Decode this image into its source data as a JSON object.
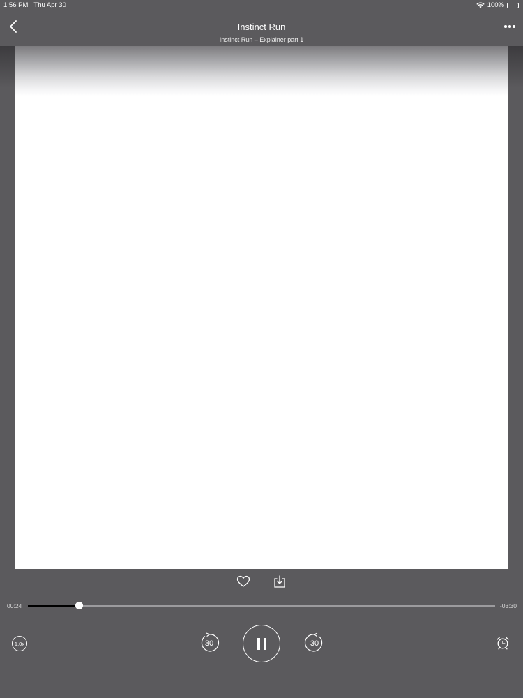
{
  "status_bar": {
    "time": "1:56 PM",
    "date": "Thu Apr 30",
    "battery": "100%",
    "icons": [
      "wifi-icon",
      "battery-icon"
    ]
  },
  "nav": {
    "title": "Instinct Run",
    "subtitle": "Instinct Run – Explainer part 1",
    "icons": [
      "chevron-left-icon",
      "more-icon"
    ]
  },
  "actions": {
    "icons": [
      "heart-icon",
      "download-icon"
    ]
  },
  "progress": {
    "elapsed": "00:24",
    "remaining": "-03:30",
    "fraction": 0.11
  },
  "controls": {
    "speed": "1.0x",
    "skip_back": "30",
    "skip_forward": "30",
    "icons": [
      "rewind-30-icon",
      "pause-icon",
      "forward-30-icon",
      "alarm-clock-icon"
    ]
  },
  "colors": {
    "background": "#5b5a5d",
    "foreground": "#ffffff",
    "progress_fill": "#000000"
  }
}
